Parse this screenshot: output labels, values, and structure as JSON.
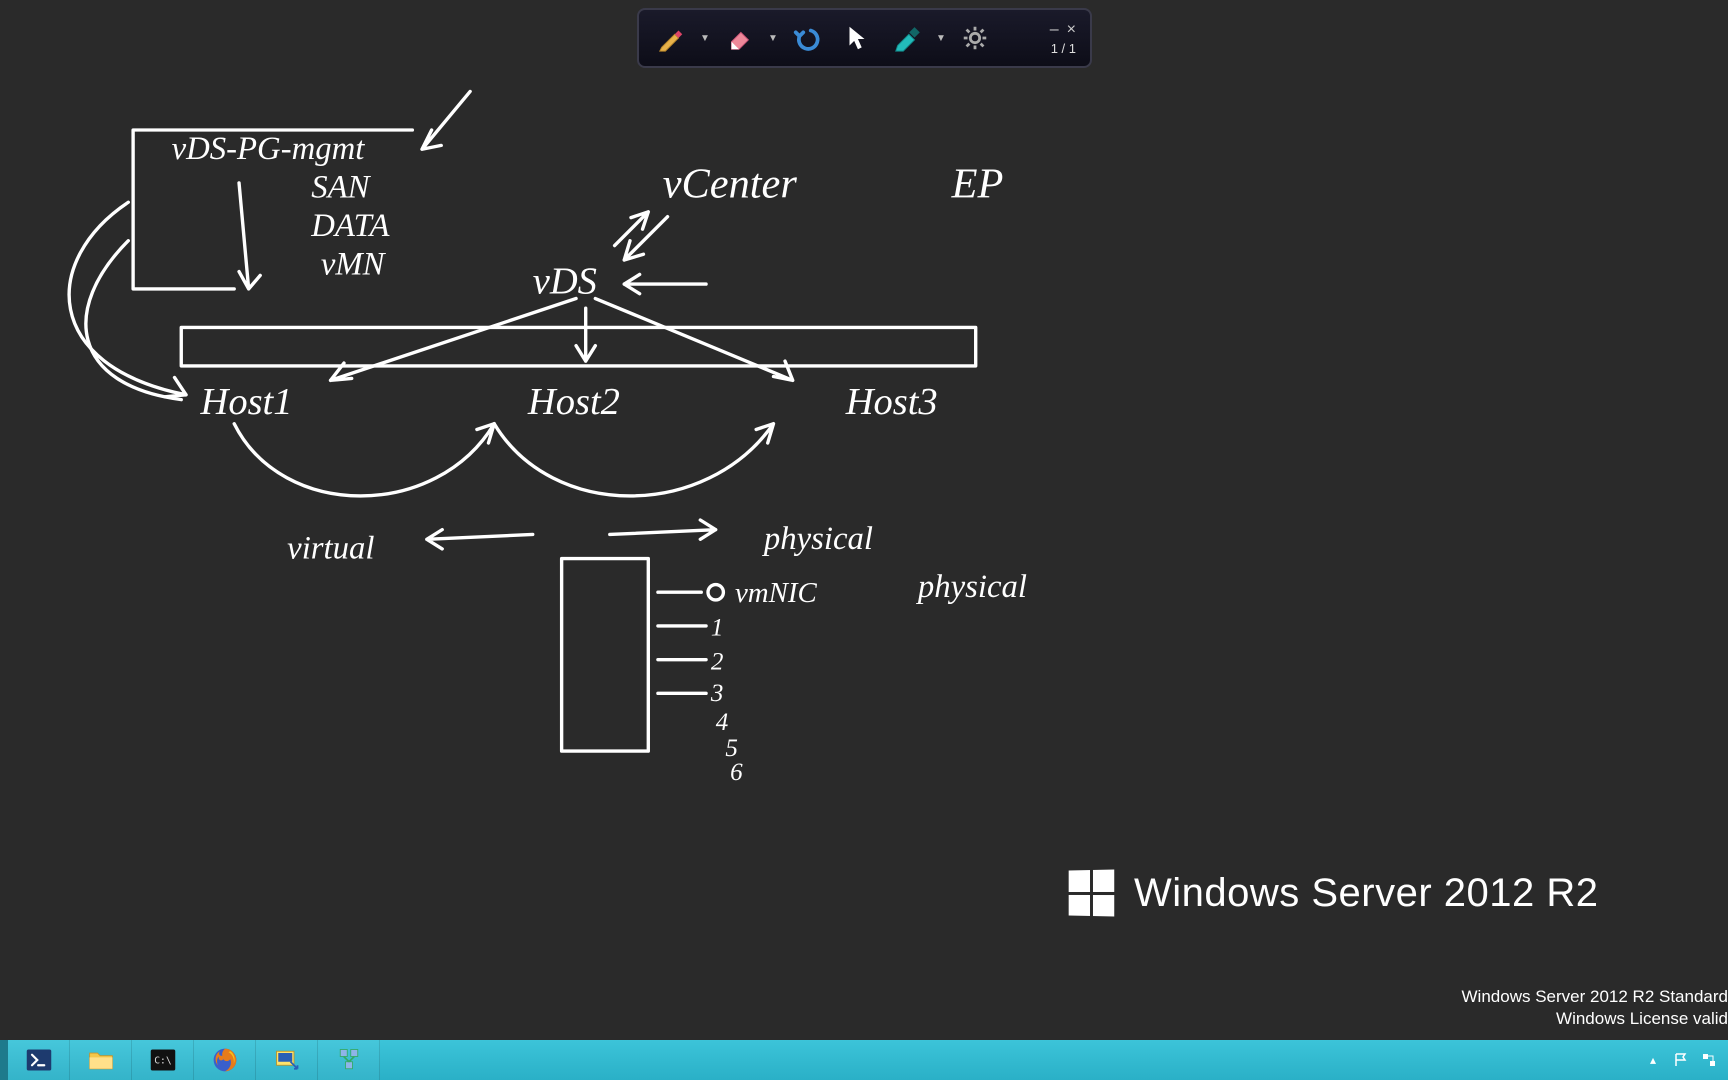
{
  "toolbar": {
    "page_indicator": "1 / 1",
    "tools": {
      "pen": "pen-tool",
      "eraser": "eraser-tool",
      "undo": "undo",
      "pointer": "pointer",
      "highlighter": "highlighter",
      "settings": "settings"
    },
    "minimize": "–",
    "close": "×"
  },
  "diagram": {
    "labels": {
      "pg_box": "vDS-PG-mgmt",
      "san": "SAN",
      "data": "DATA",
      "vmn": "vMN",
      "vcenter": "vCenter",
      "ep": "EP",
      "vds": "vDS",
      "host1": "Host1",
      "host2": "Host2",
      "host3": "Host3",
      "virtual": "virtual",
      "physical": "physical",
      "physical2": "physical",
      "vmnic": "vmNIC",
      "nic_numbers": [
        "0",
        "1",
        "2",
        "3",
        "4",
        "5",
        "6"
      ]
    }
  },
  "branding": {
    "os_name": "Windows Server 2012 R2",
    "license_line1": "Windows Server 2012 R2 Standard",
    "license_line2": "Windows License valid"
  },
  "taskbar": {
    "items": [
      {
        "name": "powershell",
        "label": "PowerShell"
      },
      {
        "name": "explorer",
        "label": "File Explorer"
      },
      {
        "name": "cmd",
        "label": "Command Prompt"
      },
      {
        "name": "firefox",
        "label": "Firefox"
      },
      {
        "name": "putty",
        "label": "PuTTY"
      },
      {
        "name": "vsphere",
        "label": "vSphere Client"
      }
    ],
    "tray": {
      "chevron": "▴",
      "flag": "flag",
      "network": "network"
    }
  }
}
